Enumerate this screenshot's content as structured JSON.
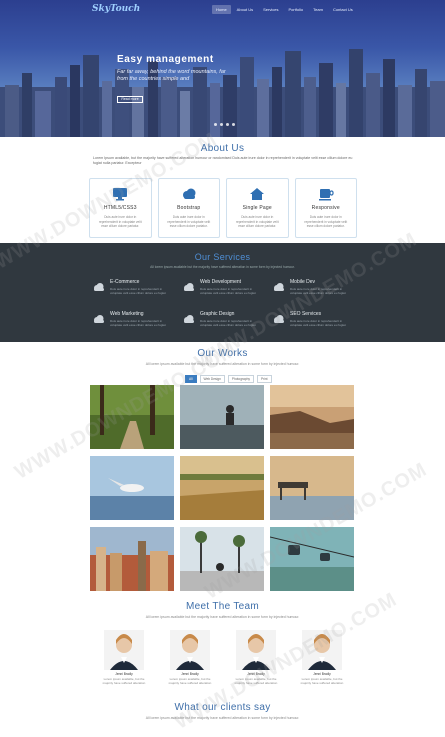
{
  "nav": {
    "logo": "SkyTouch",
    "items": [
      "Home",
      "About Us",
      "Services",
      "Portfolio",
      "Team",
      "Contact Us"
    ]
  },
  "hero": {
    "title": "Easy management",
    "subtitle": "Far far away, behind the word mountains, far from the countries simple and",
    "button": "Read more"
  },
  "about": {
    "title": "About Us",
    "lead": "Lorem Ipsum available, but the majority have suffered alteration humour or randomised Duis aute irure dolor in reprehenderit in voluptate velit esse cillum dolore eu fugiat nulla pariatur. Excepteur",
    "features": [
      {
        "icon": "monitor-icon",
        "title": "HTML5/CSS3",
        "desc": "Duis aute irure dolor in reprehenderit in voluptate velit esse cillum dolore pariatur."
      },
      {
        "icon": "cloud-icon",
        "title": "Bootstrap",
        "desc": "Duis aute irure dolor in reprehenderit in voluptate velit esse cillum dolore pariatur."
      },
      {
        "icon": "home-icon",
        "title": "Single Page",
        "desc": "Duis aute irure dolor in reprehenderit in voluptate velit esse cillum dolore pariatur."
      },
      {
        "icon": "cup-icon",
        "title": "Responsive",
        "desc": "Duis aute irure dolor in reprehenderit in voluptate velit esse cillum dolore pariatur."
      }
    ]
  },
  "services": {
    "title": "Our Services",
    "subtitle": "All lorem ipsum available but the majority have suffered alteration in some form by injected humour.",
    "items": [
      {
        "title": "E-Commerce",
        "desc": "Duis aute irure dolor in reprehenderit in voluptate velit esse cillum dolore eu fugiat"
      },
      {
        "title": "Web Development",
        "desc": "Duis aute irure dolor in reprehenderit in voluptate velit esse cillum dolore eu fugiat"
      },
      {
        "title": "Mobile Dev",
        "desc": "Duis aute irure dolor in reprehenderit in voluptate velit esse cillum dolore eu fugiat"
      },
      {
        "title": "Web Marketing",
        "desc": "Duis aute irure dolor in reprehenderit in voluptate velit esse cillum dolore eu fugiat"
      },
      {
        "title": "Graphic Design",
        "desc": "Duis aute irure dolor in reprehenderit in voluptate velit esse cillum dolore eu fugiat"
      },
      {
        "title": "SEO Services",
        "desc": "Duis aute irure dolor in reprehenderit in voluptate velit esse cillum dolore eu fugiat"
      }
    ]
  },
  "works": {
    "title": "Our Works",
    "subtitle": "All lorem ipsum available but the majority have suffered alteration in some form by injected humour.",
    "filters": [
      "All",
      "Web Design",
      "Photography",
      "Print"
    ]
  },
  "team": {
    "title": "Meet The Team",
    "subtitle": "All lorem ipsum available but the majority have suffered alteration in some form by injected humour.",
    "members": [
      {
        "name": "Jenni Brodly",
        "desc": "Lorem ipsum available, but the majority have suffered alteration"
      },
      {
        "name": "Jenni Brodly",
        "desc": "Lorem ipsum available, but the majority have suffered alteration"
      },
      {
        "name": "Jenni Brodly",
        "desc": "Lorem ipsum available, but the majority have suffered alteration"
      },
      {
        "name": "Jenni Brodly",
        "desc": "Lorem ipsum available, but the majority have suffered alteration"
      }
    ]
  },
  "clients": {
    "title": "What our clients say",
    "subtitle": "All lorem ipsum available but the majority have suffered alteration in some form by injected humour."
  },
  "watermark": "WWW.DOWNDEMO.COM",
  "colors": {
    "accent": "#3f6fa9",
    "services_bg": "#30383f",
    "filter_active": "#3a7cc0"
  }
}
